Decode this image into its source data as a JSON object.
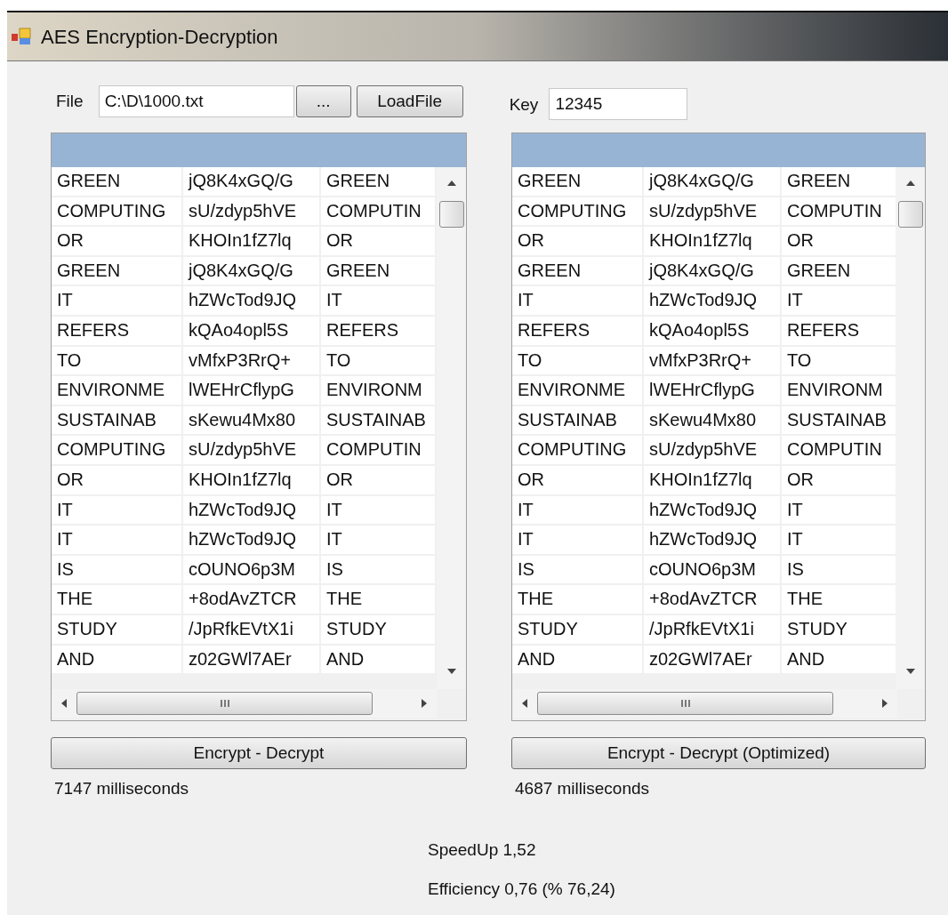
{
  "window": {
    "title": "AES Encryption-Decryption"
  },
  "file": {
    "label": "File",
    "value": "C:\\D\\1000.txt"
  },
  "browse_button": "...",
  "load_button": "LoadFile",
  "key": {
    "label": "Key",
    "value": "12345"
  },
  "panels": [
    {
      "rows": [
        [
          "GREEN",
          "jQ8K4xGQ/G",
          "GREEN"
        ],
        [
          "COMPUTING",
          "sU/zdyp5hVE",
          "COMPUTIN"
        ],
        [
          "OR",
          "KHOIn1fZ7lq",
          "OR"
        ],
        [
          "GREEN",
          "jQ8K4xGQ/G",
          "GREEN"
        ],
        [
          "IT",
          "hZWcTod9JQ",
          "IT"
        ],
        [
          "REFERS",
          "kQAo4opl5S",
          "REFERS"
        ],
        [
          "TO",
          "vMfxP3RrQ+",
          "TO"
        ],
        [
          "ENVIRONME",
          "lWEHrCflypG",
          "ENVIRONM"
        ],
        [
          "SUSTAINAB",
          "sKewu4Mx80",
          "SUSTAINAB"
        ],
        [
          "COMPUTING",
          "sU/zdyp5hVE",
          "COMPUTIN"
        ],
        [
          "OR",
          "KHOIn1fZ7lq",
          "OR"
        ],
        [
          "IT",
          "hZWcTod9JQ",
          "IT"
        ],
        [
          "IT",
          "hZWcTod9JQ",
          "IT"
        ],
        [
          "IS",
          "cOUNO6p3M",
          "IS"
        ],
        [
          "THE",
          "+8odAvZTCR",
          "THE"
        ],
        [
          "STUDY",
          "/JpRfkEVtX1i",
          "STUDY"
        ],
        [
          "AND",
          "z02GWl7AEr",
          "AND"
        ]
      ],
      "button": "Encrypt - Decrypt",
      "time": "7147 milliseconds"
    },
    {
      "rows": [
        [
          "GREEN",
          "jQ8K4xGQ/G",
          "GREEN"
        ],
        [
          "COMPUTING",
          "sU/zdyp5hVE",
          "COMPUTIN"
        ],
        [
          "OR",
          "KHOIn1fZ7lq",
          "OR"
        ],
        [
          "GREEN",
          "jQ8K4xGQ/G",
          "GREEN"
        ],
        [
          "IT",
          "hZWcTod9JQ",
          "IT"
        ],
        [
          "REFERS",
          "kQAo4opl5S",
          "REFERS"
        ],
        [
          "TO",
          "vMfxP3RrQ+",
          "TO"
        ],
        [
          "ENVIRONME",
          "lWEHrCflypG",
          "ENVIRONM"
        ],
        [
          "SUSTAINAB",
          "sKewu4Mx80",
          "SUSTAINAB"
        ],
        [
          "COMPUTING",
          "sU/zdyp5hVE",
          "COMPUTIN"
        ],
        [
          "OR",
          "KHOIn1fZ7lq",
          "OR"
        ],
        [
          "IT",
          "hZWcTod9JQ",
          "IT"
        ],
        [
          "IT",
          "hZWcTod9JQ",
          "IT"
        ],
        [
          "IS",
          "cOUNO6p3M",
          "IS"
        ],
        [
          "THE",
          "+8odAvZTCR",
          "THE"
        ],
        [
          "STUDY",
          "/JpRfkEVtX1i",
          "STUDY"
        ],
        [
          "AND",
          "z02GWl7AEr",
          "AND"
        ]
      ],
      "button": "Encrypt - Decrypt (Optimized)",
      "time": "4687 milliseconds"
    }
  ],
  "speedup": "SpeedUp 1,52",
  "efficiency": "Efficiency 0,76 (% 76,24)"
}
